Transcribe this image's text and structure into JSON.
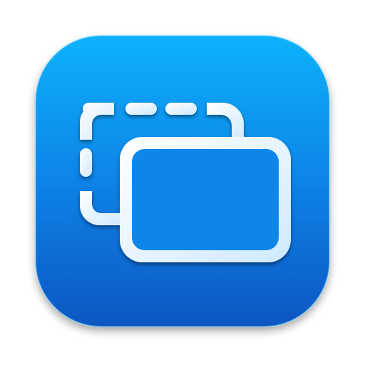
{
  "icon": {
    "name": "window-duplicate-icon",
    "colors": {
      "gradient_top": "#10b2fb",
      "gradient_mid": "#0a83e8",
      "gradient_bottom": "#0856c2",
      "glyph_fill": "#ffffff",
      "glyph_inner": "#0a8df0",
      "glyph_shadow": "#0a4fa8"
    }
  }
}
